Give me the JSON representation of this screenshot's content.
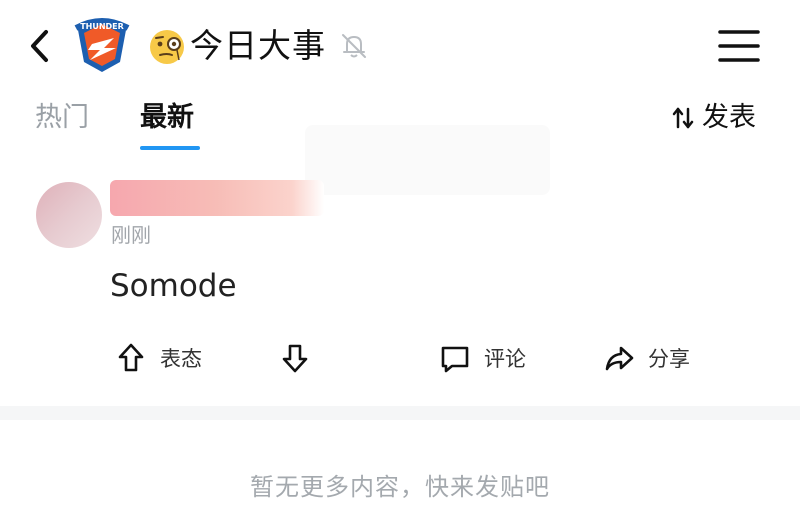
{
  "header": {
    "title": "今日大事",
    "icons": {
      "back": "chevron-left-icon",
      "logo": "thunder-logo",
      "emoji": "monocle-face-emoji",
      "mute": "bell-muted-icon",
      "menu": "hamburger-menu-icon"
    },
    "logo_text": "THUNDER"
  },
  "tabs": [
    {
      "label": "热门",
      "active": false
    },
    {
      "label": "最新",
      "active": true
    }
  ],
  "sort": {
    "label": "发表",
    "icon": "sort-arrows-icon"
  },
  "post": {
    "time": "刚刚",
    "content": "Somode",
    "actions": {
      "upvote_label": "表态",
      "comment_label": "评论",
      "share_label": "分享"
    }
  },
  "footer": {
    "text": "暂无更多内容，快来发贴吧"
  },
  "colors": {
    "accent": "#2196f3",
    "muted_text": "#9aa0a6"
  }
}
